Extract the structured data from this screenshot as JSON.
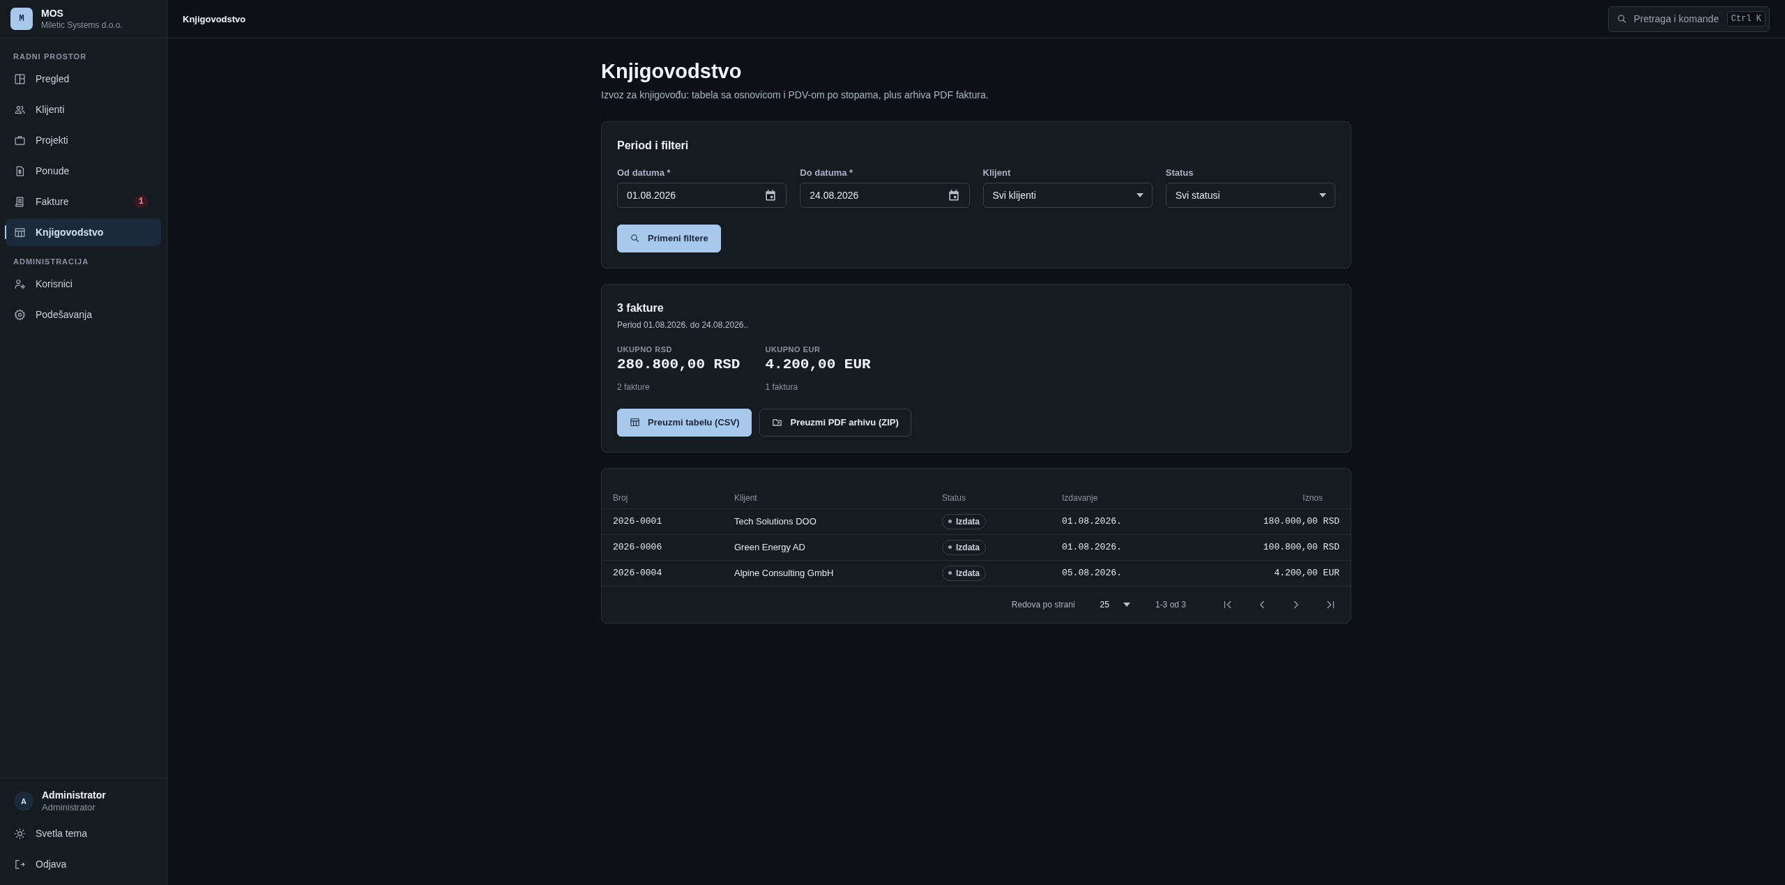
{
  "brand": {
    "logo": "M",
    "name": "MOS",
    "company": "Miletic Systems d.o.o."
  },
  "sidebar": {
    "groups": [
      {
        "title": "RADNI PROSTOR",
        "items": [
          {
            "label": "Pregled",
            "selected": false
          },
          {
            "label": "Klijenti",
            "selected": false
          },
          {
            "label": "Projekti",
            "selected": false
          },
          {
            "label": "Ponude",
            "selected": false
          },
          {
            "label": "Fakture",
            "selected": false,
            "badge": "1"
          },
          {
            "label": "Knjigovodstvo",
            "selected": true
          }
        ]
      },
      {
        "title": "ADMINISTRACIJA",
        "items": [
          {
            "label": "Korisnici",
            "selected": false
          },
          {
            "label": "Podešavanja",
            "selected": false
          }
        ]
      }
    ]
  },
  "user": {
    "avatar": "A",
    "name": "Administrator",
    "role": "Administrator"
  },
  "footer_items": [
    "Svetla tema",
    "Odjava"
  ],
  "header": {
    "title": "Knjigovodstvo",
    "search": {
      "placeholder": "Pretraga i komande",
      "shortcut": "Ctrl K"
    }
  },
  "page": {
    "title": "Knjigovodstvo",
    "subtitle": "Izvoz za knjigovođu: tabela sa osnovicom i PDV-om po stopama, plus arhiva PDF faktura."
  },
  "filters": {
    "title": "Period i filteri",
    "fields": [
      {
        "kind": "date",
        "label": "Od datuma",
        "mark": "*",
        "value": "01.08.2026"
      },
      {
        "kind": "date",
        "label": "Do datuma",
        "mark": "*",
        "value": "24.08.2026"
      },
      {
        "kind": "select",
        "label": "Klijent",
        "value": "Svi klijenti"
      },
      {
        "kind": "select",
        "label": "Status",
        "value": "Svi statusi"
      }
    ],
    "button": "Primeni filtere"
  },
  "summary": {
    "title": "3 fakture",
    "period": "Period 01.08.2026. do 24.08.2026..",
    "totals": [
      {
        "label": "UKUPNO RSD",
        "value": "280.800,00 RSD",
        "note": "2 fakture"
      },
      {
        "label": "UKUPNO EUR",
        "value": "4.200,00 EUR",
        "note": "1 faktura"
      }
    ],
    "buttons": [
      {
        "label": "Preuzmi tabelu (CSV)",
        "kind": "primary"
      },
      {
        "label": "Preuzmi PDF arhivu (ZIP)",
        "kind": "outline"
      }
    ]
  },
  "table": {
    "columns": [
      "Broj",
      "Klijent",
      "Status",
      "Izdavanje",
      "Iznos"
    ],
    "rows": [
      [
        "2026-0001",
        "Tech Solutions DOO",
        "Izdata",
        "01.08.2026.",
        "180.000,00 RSD"
      ],
      [
        "2026-0006",
        "Green Energy AD",
        "Izdata",
        "01.08.2026.",
        "100.800,00 RSD"
      ],
      [
        "2026-0004",
        "Alpine Consulting GmbH",
        "Izdata",
        "05.08.2026.",
        "4.200,00 EUR"
      ]
    ],
    "pagination": {
      "rows_label": "Redova po strani",
      "rows_value": "25",
      "range": "1-3 od 3"
    }
  }
}
